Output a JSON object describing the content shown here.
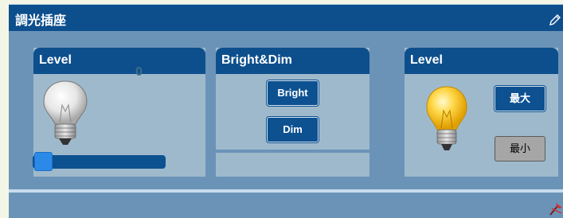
{
  "panel": {
    "title": "調光插座"
  },
  "cards": {
    "level": {
      "title": "Level",
      "value": "0",
      "slider_level": 0
    },
    "bright_dim": {
      "title": "Bright&Dim",
      "bright_label": "Bright",
      "dim_label": "Dim"
    },
    "level2": {
      "title": "Level",
      "max_label": "最大",
      "min_label": "最小"
    }
  },
  "icons": {
    "edit": "pencil-icon",
    "bulb_off": "lightbulb-off-icon",
    "bulb_on": "lightbulb-on-icon",
    "footer": "pin-icon"
  },
  "colors": {
    "header": "#0d4f8d",
    "panel_bg": "#6b93b8",
    "card_bg": "#9fb9cc",
    "slider_handle": "#2b8ae8"
  }
}
